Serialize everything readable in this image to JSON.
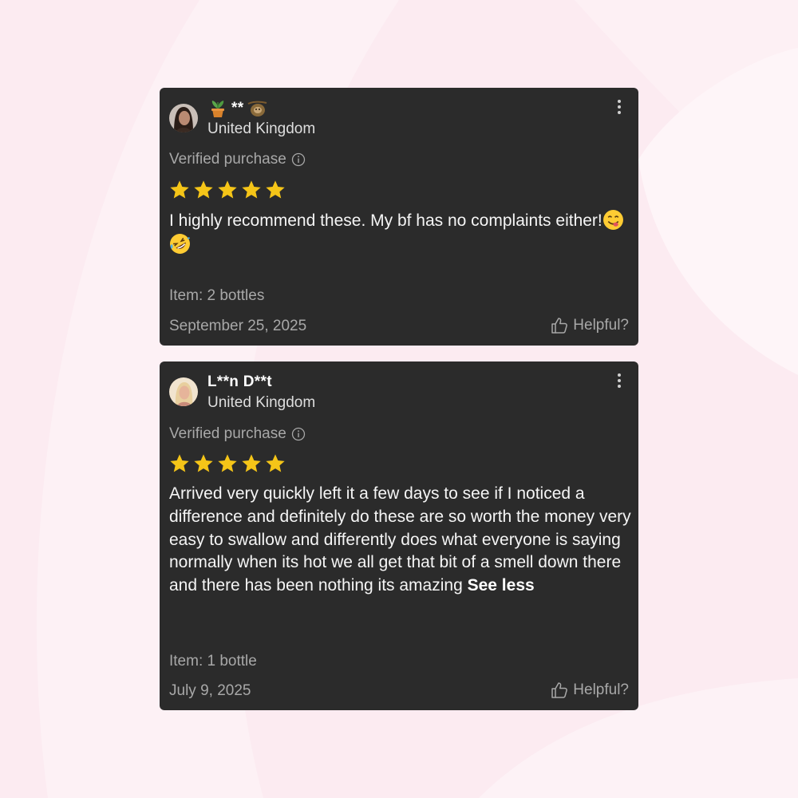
{
  "colors": {
    "background": "#fcebf1",
    "card": "#2b2b2b",
    "star": "#f5c518",
    "muted_text": "#a8a8a8"
  },
  "reviews": [
    {
      "name": "**",
      "name_icons": [
        "potted-plant-icon",
        "sloth-icon"
      ],
      "country": "United Kingdom",
      "verified_label": "Verified purchase",
      "rating": 5,
      "text": "I highly recommend these. My bf has no complaints either!",
      "text_emojis": [
        "yum-face-emoji",
        "rofl-face-emoji"
      ],
      "item": "Item: 2 bottles",
      "date": "September 25, 2025",
      "helpful_label": "Helpful?"
    },
    {
      "name": "L**n D**t",
      "country": "United Kingdom",
      "verified_label": "Verified purchase",
      "rating": 5,
      "text": "Arrived very quickly left it a few days to see if I noticed a difference and definitely do these are so worth the money very easy to swallow and differently does what everyone is saying normally when its hot we all get that bit of a smell down there and there has been nothing its amazing",
      "see_less_label": "See less",
      "item": "Item: 1 bottle",
      "date": "July 9, 2025",
      "helpful_label": "Helpful?"
    }
  ]
}
